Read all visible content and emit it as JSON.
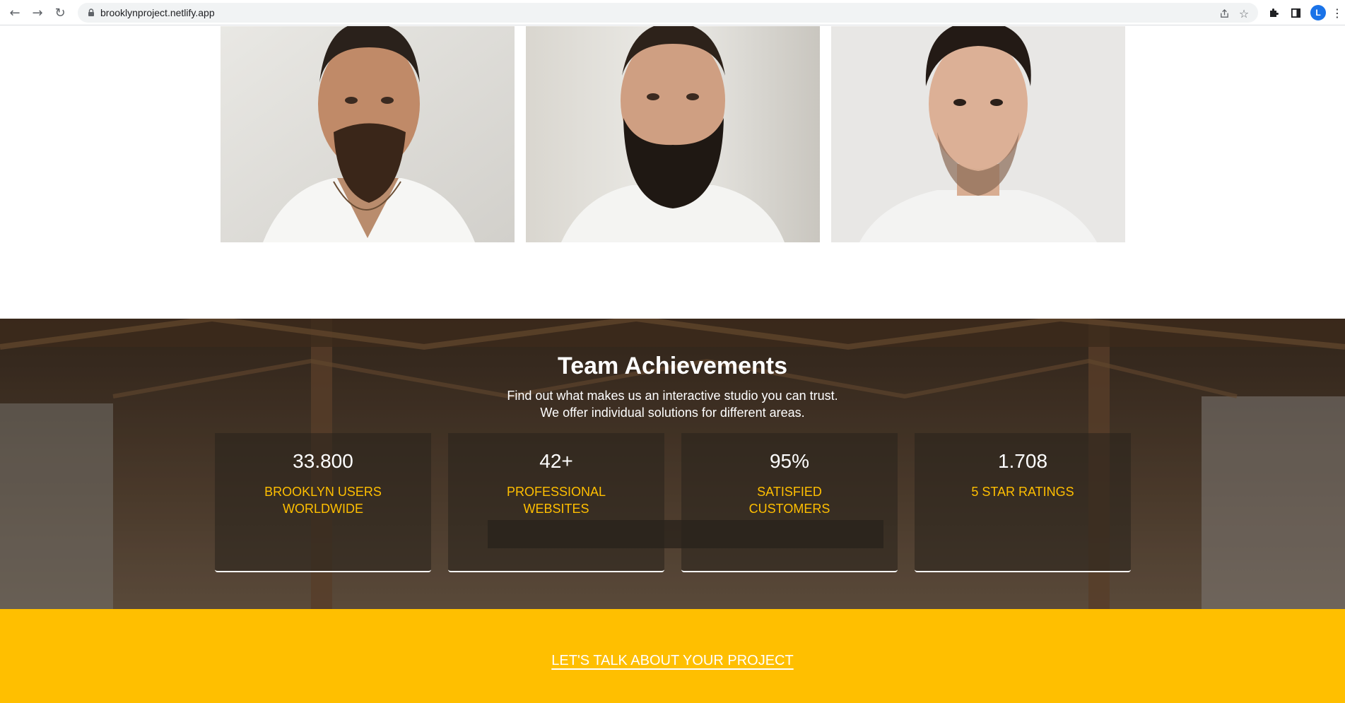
{
  "browser": {
    "url": "brooklynproject.netlify.app",
    "profile_initial": "L",
    "icons": {
      "back": "arrow-left-icon",
      "forward": "arrow-right-icon",
      "reload": "reload-icon",
      "lock": "lock-icon",
      "share": "share-icon",
      "bookmark": "star-icon",
      "extensions": "puzzle-icon",
      "side_panel": "side-panel-icon",
      "menu": "kebab-menu-icon"
    }
  },
  "team": {
    "portraits": [
      {
        "icon": "portrait-man-moustache-photo"
      },
      {
        "icon": "portrait-man-full-beard-photo"
      },
      {
        "icon": "portrait-man-stubble-photo"
      }
    ]
  },
  "achievements": {
    "title": "Team Achievements",
    "subtitle_line1": "Find out what makes us an interactive studio you can trust.",
    "subtitle_line2": "We offer individual solutions for different areas.",
    "stats": [
      {
        "value": "33.800",
        "label_line1": "BROOKLYN USERS",
        "label_line2": "WORLDWIDE"
      },
      {
        "value": "42+",
        "label_line1": "PROFESSIONAL",
        "label_line2": "WEBSITES"
      },
      {
        "value": "95%",
        "label_line1": "SATISFIED",
        "label_line2": "CUSTOMERS"
      },
      {
        "value": "1.708",
        "label_line1": "5 STAR RATINGS",
        "label_line2": ""
      }
    ]
  },
  "cta": {
    "link_text": "LET'S TALK ABOUT YOUR PROJECT"
  },
  "colors": {
    "accent": "#ffbf00",
    "text_light": "#ffffff"
  }
}
